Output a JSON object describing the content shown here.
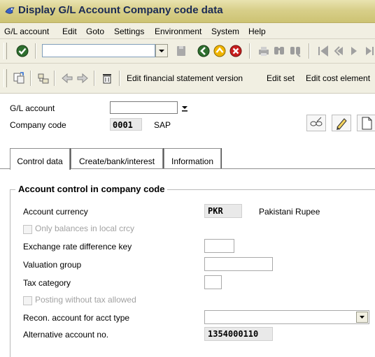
{
  "window": {
    "title": "Display G/L Account Company code data",
    "app_icon": "sap-window-icon"
  },
  "menu": [
    "G/L account",
    "Edit",
    "Goto",
    "Settings",
    "Environment",
    "System",
    "Help"
  ],
  "toolbar": {
    "command_field_value": "",
    "icons": [
      "enter-icon",
      "save-icon",
      "back-icon",
      "exit-icon",
      "cancel-icon",
      "print-icon",
      "find-icon",
      "find-next-icon",
      "first-page-icon",
      "previous-page-icon"
    ]
  },
  "app_toolbar": {
    "icons": [
      "other-object-icon",
      "hierarchy-icon",
      "previous-icon",
      "next-icon",
      "delete-icon"
    ],
    "buttons": [
      "Edit financial statement version",
      "Edit set",
      "Edit cost element"
    ]
  },
  "header": {
    "gl_account_label": "G/L account",
    "gl_account_value": "",
    "company_code_label": "Company code",
    "company_code_value": "0001",
    "company_code_name": "SAP",
    "action_icons": [
      "display-change-toggle-icon",
      "change-pencil-icon",
      "create-new-icon"
    ]
  },
  "tabs": [
    {
      "label": "Control data",
      "active": true
    },
    {
      "label": "Create/bank/interest",
      "active": false
    },
    {
      "label": "Information",
      "active": false
    }
  ],
  "group": {
    "title": "Account control in company code",
    "rows": {
      "account_currency": {
        "label": "Account currency",
        "value": "PKR",
        "description": "Pakistani Rupee"
      },
      "only_balances": {
        "label": "Only balances in local crcy",
        "checked": false,
        "enabled": false
      },
      "exchange_rate_key": {
        "label": "Exchange rate difference key",
        "value": ""
      },
      "valuation_group": {
        "label": "Valuation group",
        "value": ""
      },
      "tax_category": {
        "label": "Tax category",
        "value": ""
      },
      "posting_without_tax": {
        "label": "Posting without tax allowed",
        "checked": false,
        "enabled": false
      },
      "recon_account": {
        "label": "Recon. account for acct type",
        "value": ""
      },
      "alternative_account": {
        "label": "Alternative account no.",
        "value": "1354000110"
      }
    }
  }
}
